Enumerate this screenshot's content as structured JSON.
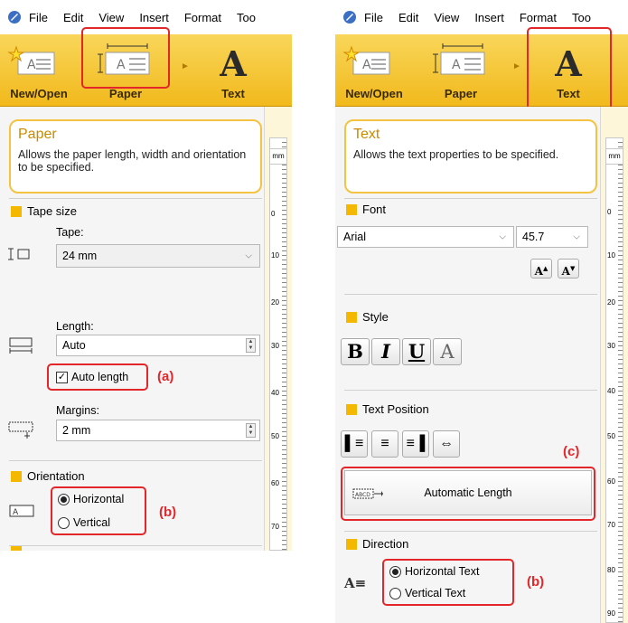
{
  "menu": {
    "file": "File",
    "edit": "Edit",
    "view": "View",
    "insert": "Insert",
    "format": "Format",
    "tools_truncated": "Too"
  },
  "ribbon": {
    "new_open_label": "New/Open",
    "paper_label": "Paper",
    "text_label": "Text"
  },
  "left": {
    "title": "Paper",
    "description": "Allows the paper length, width and orientation to be specified.",
    "ruler_unit": "mm",
    "tape_size": {
      "section": "Tape size",
      "tape_label": "Tape:",
      "tape_value": "24 mm",
      "length_label": "Length:",
      "length_value": "Auto",
      "auto_length_label": "Auto length",
      "auto_length_checked": true,
      "margins_label": "Margins:",
      "margins_value": "2 mm"
    },
    "orientation": {
      "section": "Orientation",
      "horizontal": "Horizontal",
      "vertical": "Vertical",
      "selected": "Horizontal"
    },
    "annotations": {
      "a": "(a)",
      "b": "(b)"
    },
    "ruler_marks": [
      "0",
      "10",
      "20",
      "30",
      "40",
      "50",
      "60",
      "70"
    ]
  },
  "right": {
    "title": "Text",
    "description": "Allows the text properties to be specified.",
    "ruler_unit": "mm",
    "font": {
      "section": "Font",
      "font_value": "Arial",
      "size_value": "45.7"
    },
    "style": {
      "section": "Style",
      "bold": "B",
      "italic": "I",
      "underline": "U"
    },
    "text_position": {
      "section": "Text Position",
      "auto_length_button": "Automatic Length",
      "auto_length_icon_text": "ABCD"
    },
    "direction": {
      "section": "Direction",
      "horizontal": "Horizontal Text",
      "vertical": "Vertical Text",
      "selected": "Horizontal Text"
    },
    "annotations": {
      "c": "(c)",
      "b": "(b)"
    },
    "ruler_marks": [
      "0",
      "10",
      "20",
      "30",
      "40",
      "50",
      "60",
      "70",
      "80",
      "90"
    ]
  },
  "colors": {
    "highlight": "#e2262a",
    "ribbon": "#f1b91c",
    "section_square": "#f5b800",
    "title_text": "#c88a00"
  }
}
